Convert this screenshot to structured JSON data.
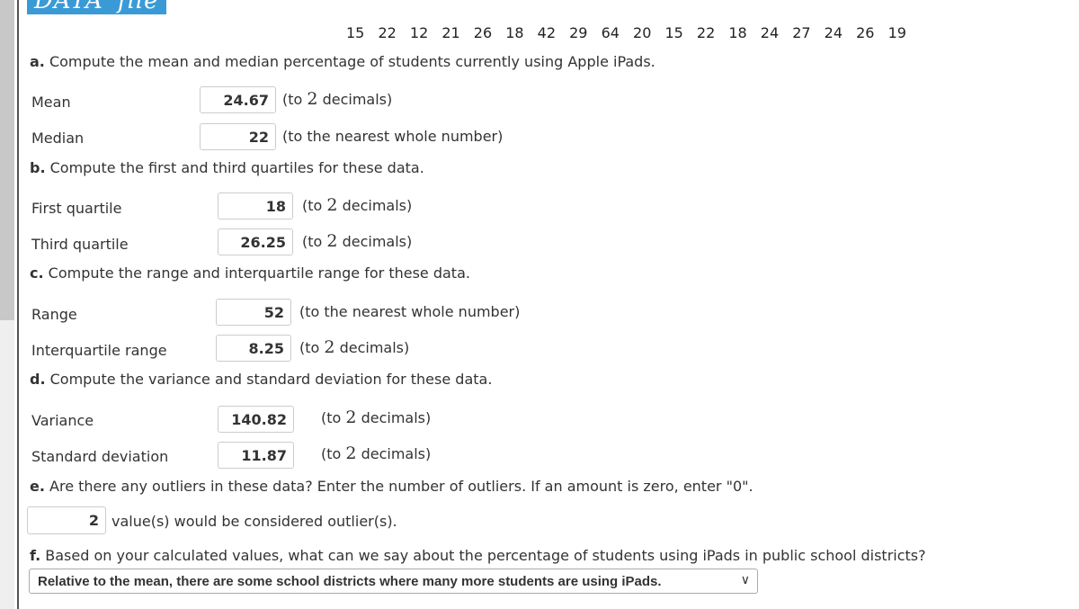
{
  "logo": {
    "text": "DATA",
    "accent": "file"
  },
  "data_values": "15 22 12 21 26 18 42 29 64 20 15 22 18 24 27 24 26 19",
  "a": {
    "letter": "a.",
    "question": "Compute the mean and median percentage of students currently using Apple iPads.",
    "mean": {
      "label": "Mean",
      "value": "24.67",
      "hint_pre": "(to ",
      "hint_num": "2",
      "hint_post": " decimals)"
    },
    "median": {
      "label": "Median",
      "value": "22",
      "hint": "(to the nearest whole number)"
    }
  },
  "b": {
    "letter": "b.",
    "question": "Compute the first and third quartiles for these data.",
    "q1": {
      "label": "First quartile",
      "value": "18",
      "hint_pre": "(to ",
      "hint_num": "2",
      "hint_post": " decimals)"
    },
    "q3": {
      "label": "Third quartile",
      "value": "26.25",
      "hint_pre": "(to ",
      "hint_num": "2",
      "hint_post": " decimals)"
    }
  },
  "c": {
    "letter": "c.",
    "question": "Compute the range and interquartile range for these data.",
    "range": {
      "label": "Range",
      "value": "52",
      "hint": "(to the nearest whole number)"
    },
    "iqr": {
      "label": "Interquartile range",
      "value": "8.25",
      "hint_pre": "(to ",
      "hint_num": "2",
      "hint_post": " decimals)"
    }
  },
  "d": {
    "letter": "d.",
    "question": "Compute the variance and standard deviation for these data.",
    "variance": {
      "label": "Variance",
      "value": "140.82",
      "hint_pre": "(to ",
      "hint_num": "2",
      "hint_post": " decimals)"
    },
    "sd": {
      "label": "Standard deviation",
      "value": "11.87",
      "hint_pre": "(to ",
      "hint_num": "2",
      "hint_post": " decimals)"
    }
  },
  "e": {
    "letter": "e.",
    "question": "Are there any outliers in these data? Enter the number of outliers. If an amount is zero, enter \"0\".",
    "value": "2",
    "suffix": "value(s) would be considered outlier(s)."
  },
  "f": {
    "letter": "f.",
    "question": "Based on your calculated values, what can we say about the percentage of students using iPads in public school districts?",
    "selected": "Relative to the mean, there are some school districts where many more students are using iPads."
  }
}
